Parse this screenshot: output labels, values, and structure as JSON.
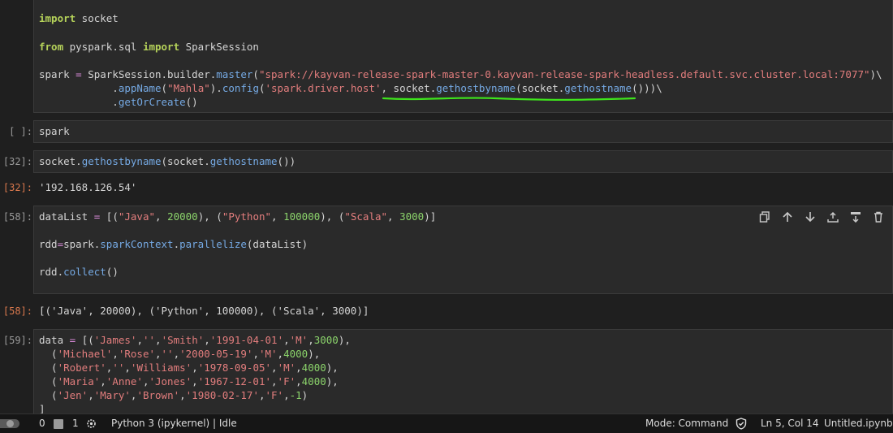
{
  "cells": [
    {
      "prompt": "",
      "lines": [
        [
          {
            "t": "import",
            "c": "kw"
          },
          {
            "t": " socket",
            "c": "pl"
          }
        ],
        [],
        [
          {
            "t": "from",
            "c": "kw"
          },
          {
            "t": " pyspark.sql ",
            "c": "pl"
          },
          {
            "t": "import",
            "c": "kw"
          },
          {
            "t": " SparkSession",
            "c": "pl"
          }
        ],
        [],
        [
          {
            "t": "spark ",
            "c": "pl"
          },
          {
            "t": "=",
            "c": "op"
          },
          {
            "t": " SparkSession.builder.",
            "c": "pl"
          },
          {
            "t": "master",
            "c": "fn"
          },
          {
            "t": "(",
            "c": "pl"
          },
          {
            "t": "\"spark://kayvan-release-spark-master-0.kayvan-release-spark-headless.default.svc.cluster.local:7077\"",
            "c": "str"
          },
          {
            "t": ")\\",
            "c": "pl"
          }
        ],
        [
          {
            "t": "            .",
            "c": "pl"
          },
          {
            "t": "appName",
            "c": "fn"
          },
          {
            "t": "(",
            "c": "pl"
          },
          {
            "t": "\"Mahla\"",
            "c": "str"
          },
          {
            "t": ").",
            "c": "pl"
          },
          {
            "t": "config",
            "c": "fn"
          },
          {
            "t": "(",
            "c": "pl"
          },
          {
            "t": "'spark.driver.host'",
            "c": "str"
          },
          {
            "t": ", socket.",
            "c": "pl"
          },
          {
            "t": "gethostbyname",
            "c": "fn"
          },
          {
            "t": "(socket.",
            "c": "pl"
          },
          {
            "t": "gethostname",
            "c": "fn"
          },
          {
            "t": "()))\\",
            "c": "pl"
          }
        ],
        [
          {
            "t": "            .",
            "c": "pl"
          },
          {
            "t": "getOrCreate",
            "c": "fn"
          },
          {
            "t": "()",
            "c": "pl"
          }
        ]
      ]
    },
    {
      "prompt": "[ ]:",
      "lines": [
        [
          {
            "t": "spark",
            "c": "pl"
          }
        ]
      ]
    },
    {
      "prompt": "[32]:",
      "lines": [
        [
          {
            "t": "socket.",
            "c": "pl"
          },
          {
            "t": "gethostbyname",
            "c": "fn"
          },
          {
            "t": "(socket.",
            "c": "pl"
          },
          {
            "t": "gethostname",
            "c": "fn"
          },
          {
            "t": "())",
            "c": "pl"
          }
        ]
      ],
      "output_prompt": "[32]:",
      "output": "'192.168.126.54'"
    },
    {
      "prompt": "[58]:",
      "lines": [
        [
          {
            "t": "dataList ",
            "c": "pl"
          },
          {
            "t": "=",
            "c": "op"
          },
          {
            "t": " [(",
            "c": "pl"
          },
          {
            "t": "\"Java\"",
            "c": "str"
          },
          {
            "t": ", ",
            "c": "pl"
          },
          {
            "t": "20000",
            "c": "num"
          },
          {
            "t": "), (",
            "c": "pl"
          },
          {
            "t": "\"Python\"",
            "c": "str"
          },
          {
            "t": ", ",
            "c": "pl"
          },
          {
            "t": "100000",
            "c": "num"
          },
          {
            "t": "), (",
            "c": "pl"
          },
          {
            "t": "\"Scala\"",
            "c": "str"
          },
          {
            "t": ", ",
            "c": "pl"
          },
          {
            "t": "3000",
            "c": "num"
          },
          {
            "t": ")]",
            "c": "pl"
          }
        ],
        [],
        [
          {
            "t": "rdd",
            "c": "pl"
          },
          {
            "t": "=",
            "c": "op"
          },
          {
            "t": "spark.",
            "c": "pl"
          },
          {
            "t": "sparkContext",
            "c": "fn"
          },
          {
            "t": ".",
            "c": "pl"
          },
          {
            "t": "parallelize",
            "c": "fn"
          },
          {
            "t": "(dataList)",
            "c": "pl"
          }
        ],
        [],
        [
          {
            "t": "rdd.",
            "c": "pl"
          },
          {
            "t": "collect",
            "c": "fn"
          },
          {
            "t": "()",
            "c": "pl"
          }
        ]
      ],
      "output_prompt": "[58]:",
      "output": "[('Java', 20000), ('Python', 100000), ('Scala', 3000)]"
    },
    {
      "prompt": "[59]:",
      "lines": [
        [
          {
            "t": "data ",
            "c": "pl"
          },
          {
            "t": "=",
            "c": "op"
          },
          {
            "t": " [(",
            "c": "pl"
          },
          {
            "t": "'James'",
            "c": "str"
          },
          {
            "t": ",",
            "c": "pl"
          },
          {
            "t": "''",
            "c": "str"
          },
          {
            "t": ",",
            "c": "pl"
          },
          {
            "t": "'Smith'",
            "c": "str"
          },
          {
            "t": ",",
            "c": "pl"
          },
          {
            "t": "'1991-04-01'",
            "c": "str"
          },
          {
            "t": ",",
            "c": "pl"
          },
          {
            "t": "'M'",
            "c": "str"
          },
          {
            "t": ",",
            "c": "pl"
          },
          {
            "t": "3000",
            "c": "num"
          },
          {
            "t": "),",
            "c": "pl"
          }
        ],
        [
          {
            "t": "  (",
            "c": "pl"
          },
          {
            "t": "'Michael'",
            "c": "str"
          },
          {
            "t": ",",
            "c": "pl"
          },
          {
            "t": "'Rose'",
            "c": "str"
          },
          {
            "t": ",",
            "c": "pl"
          },
          {
            "t": "''",
            "c": "str"
          },
          {
            "t": ",",
            "c": "pl"
          },
          {
            "t": "'2000-05-19'",
            "c": "str"
          },
          {
            "t": ",",
            "c": "pl"
          },
          {
            "t": "'M'",
            "c": "str"
          },
          {
            "t": ",",
            "c": "pl"
          },
          {
            "t": "4000",
            "c": "num"
          },
          {
            "t": "),",
            "c": "pl"
          }
        ],
        [
          {
            "t": "  (",
            "c": "pl"
          },
          {
            "t": "'Robert'",
            "c": "str"
          },
          {
            "t": ",",
            "c": "pl"
          },
          {
            "t": "''",
            "c": "str"
          },
          {
            "t": ",",
            "c": "pl"
          },
          {
            "t": "'Williams'",
            "c": "str"
          },
          {
            "t": ",",
            "c": "pl"
          },
          {
            "t": "'1978-09-05'",
            "c": "str"
          },
          {
            "t": ",",
            "c": "pl"
          },
          {
            "t": "'M'",
            "c": "str"
          },
          {
            "t": ",",
            "c": "pl"
          },
          {
            "t": "4000",
            "c": "num"
          },
          {
            "t": "),",
            "c": "pl"
          }
        ],
        [
          {
            "t": "  (",
            "c": "pl"
          },
          {
            "t": "'Maria'",
            "c": "str"
          },
          {
            "t": ",",
            "c": "pl"
          },
          {
            "t": "'Anne'",
            "c": "str"
          },
          {
            "t": ",",
            "c": "pl"
          },
          {
            "t": "'Jones'",
            "c": "str"
          },
          {
            "t": ",",
            "c": "pl"
          },
          {
            "t": "'1967-12-01'",
            "c": "str"
          },
          {
            "t": ",",
            "c": "pl"
          },
          {
            "t": "'F'",
            "c": "str"
          },
          {
            "t": ",",
            "c": "pl"
          },
          {
            "t": "4000",
            "c": "num"
          },
          {
            "t": "),",
            "c": "pl"
          }
        ],
        [
          {
            "t": "  (",
            "c": "pl"
          },
          {
            "t": "'Jen'",
            "c": "str"
          },
          {
            "t": ",",
            "c": "pl"
          },
          {
            "t": "'Mary'",
            "c": "str"
          },
          {
            "t": ",",
            "c": "pl"
          },
          {
            "t": "'Brown'",
            "c": "str"
          },
          {
            "t": ",",
            "c": "pl"
          },
          {
            "t": "'1980-02-17'",
            "c": "str"
          },
          {
            "t": ",",
            "c": "pl"
          },
          {
            "t": "'F'",
            "c": "str"
          },
          {
            "t": ",",
            "c": "pl"
          },
          {
            "t": "-1",
            "c": "num"
          },
          {
            "t": ")",
            "c": "pl"
          }
        ],
        [
          {
            "t": "]",
            "c": "pl"
          }
        ]
      ]
    }
  ],
  "cell_toolbar": [
    "copy-icon",
    "move-up-icon",
    "move-down-icon",
    "insert-above-icon",
    "insert-below-icon",
    "delete-icon"
  ],
  "status": {
    "terminals": "0",
    "kernels": "1",
    "kernel": "Python 3 (ipykernel) | Idle",
    "mode": "Mode: Command",
    "position": "Ln 5, Col 14",
    "filename": "Untitled.ipynb"
  },
  "colors": {
    "annotation_underline": "#3ee41c",
    "output_prompt": "#d9784d"
  }
}
